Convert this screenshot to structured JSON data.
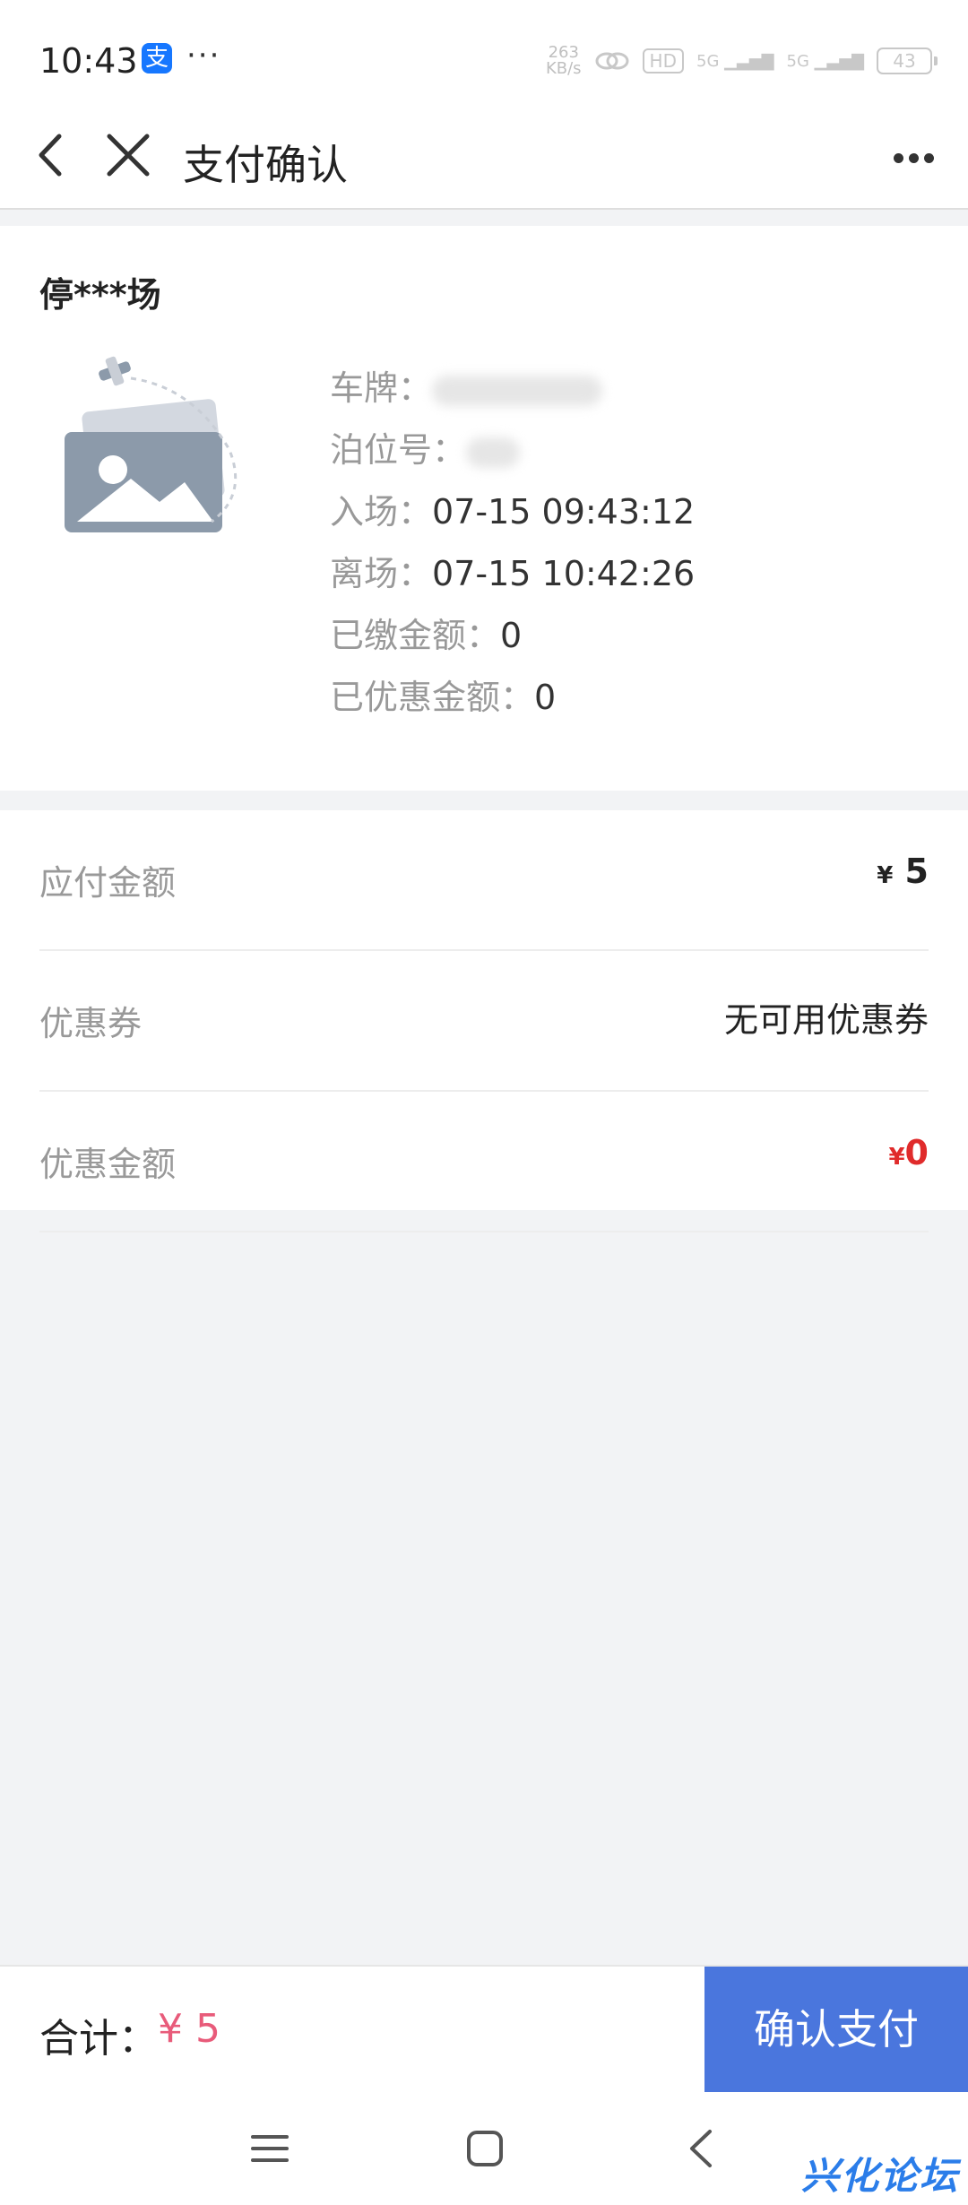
{
  "status_bar": {
    "time": "10:43",
    "app_icon": "支",
    "dots": "···",
    "net_speed_value": "263",
    "net_speed_unit": "KB/s",
    "hd": "HD",
    "signal_1": "5G",
    "signal_2": "5G",
    "battery": "43"
  },
  "nav": {
    "title": "支付确认"
  },
  "parking": {
    "name": "停***场",
    "plate_label": "车牌：",
    "slot_label": "泊位号：",
    "entry_label": "入场：",
    "entry_value": "07-15 09:43:12",
    "exit_label": "离场：",
    "exit_value": "07-15 10:42:26",
    "paid_label": "已缴金额：",
    "paid_value": "0",
    "discounted_label": "已优惠金额：",
    "discounted_value": "0"
  },
  "summary": {
    "due_label": "应付金额",
    "due_currency": "¥",
    "due_value": "5",
    "coupon_label": "优惠券",
    "coupon_value": "无可用优惠券",
    "discount_label": "优惠金额",
    "discount_currency": "¥",
    "discount_value": "0"
  },
  "footer": {
    "total_label": "合计：",
    "total_value": "¥ 5",
    "pay_button": "确认支付"
  },
  "watermark": "兴化论坛",
  "colors": {
    "primary_button": "#4a76dd",
    "discount_red": "#e02b2b",
    "total_pink": "#e85b7a",
    "page_bg": "#f2f3f5"
  },
  "icons": [
    "back-icon",
    "close-icon",
    "more-icon",
    "image-placeholder-icon",
    "menu-icon",
    "home-icon",
    "system-back-icon"
  ]
}
